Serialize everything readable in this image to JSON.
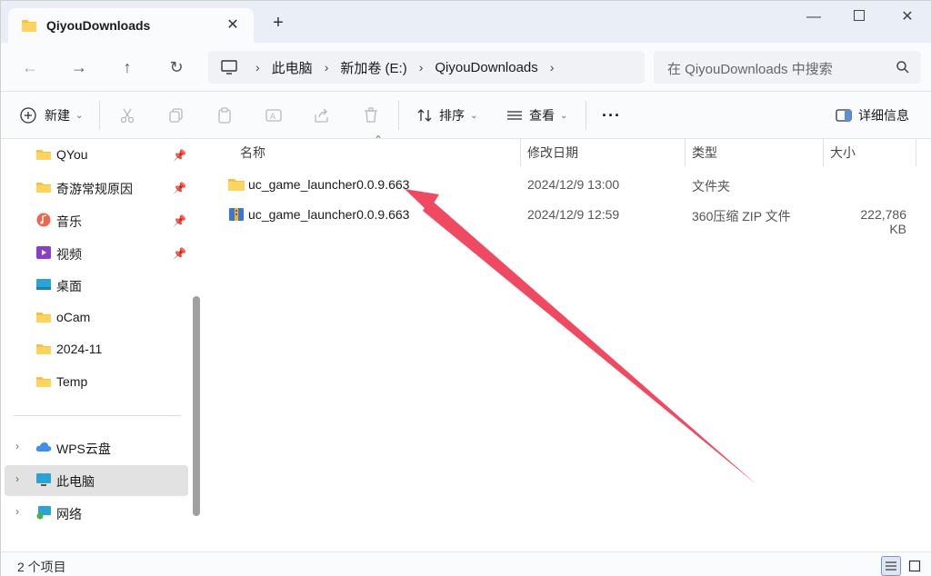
{
  "tab": {
    "title": "QiyouDownloads"
  },
  "address": {
    "crumbs": [
      "此电脑",
      "新加卷 (E:)",
      "QiyouDownloads"
    ]
  },
  "search": {
    "placeholder": "在 QiyouDownloads 中搜索"
  },
  "toolbar": {
    "new_label": "新建",
    "sort_label": "排序",
    "view_label": "查看",
    "details_label": "详细信息"
  },
  "sidebar": {
    "quick": [
      {
        "label": "QYou",
        "icon": "folder-icon",
        "pinned": true
      },
      {
        "label": "奇游常规原因",
        "icon": "folder-icon",
        "pinned": true
      },
      {
        "label": "音乐",
        "icon": "music-icon",
        "pinned": true
      },
      {
        "label": "视频",
        "icon": "video-icon",
        "pinned": true
      },
      {
        "label": "桌面",
        "icon": "desktop-icon",
        "pinned": false
      },
      {
        "label": "oCam",
        "icon": "folder-icon",
        "pinned": false
      },
      {
        "label": "2024-11",
        "icon": "folder-icon",
        "pinned": false
      },
      {
        "label": "Temp",
        "icon": "folder-icon",
        "pinned": false
      }
    ],
    "locations": [
      {
        "label": "WPS云盘",
        "icon": "cloud-icon"
      },
      {
        "label": "此电脑",
        "icon": "computer-icon"
      },
      {
        "label": "网络",
        "icon": "network-icon"
      }
    ]
  },
  "columns": {
    "name": "名称",
    "date": "修改日期",
    "type": "类型",
    "size": "大小"
  },
  "files": [
    {
      "name": "uc_game_launcher0.0.9.663",
      "date": "2024/12/9 13:00",
      "type": "文件夹",
      "size": "",
      "icon": "folder-icon"
    },
    {
      "name": "uc_game_launcher0.0.9.663",
      "date": "2024/12/9 12:59",
      "type": "360压缩 ZIP 文件",
      "size": "222,786 KB",
      "icon": "zip-archive-icon"
    }
  ],
  "status": {
    "count": "2 个项目"
  },
  "colors": {
    "accent": "#0067c0",
    "arrow": "#f04a63",
    "folder": "#f5c242"
  }
}
